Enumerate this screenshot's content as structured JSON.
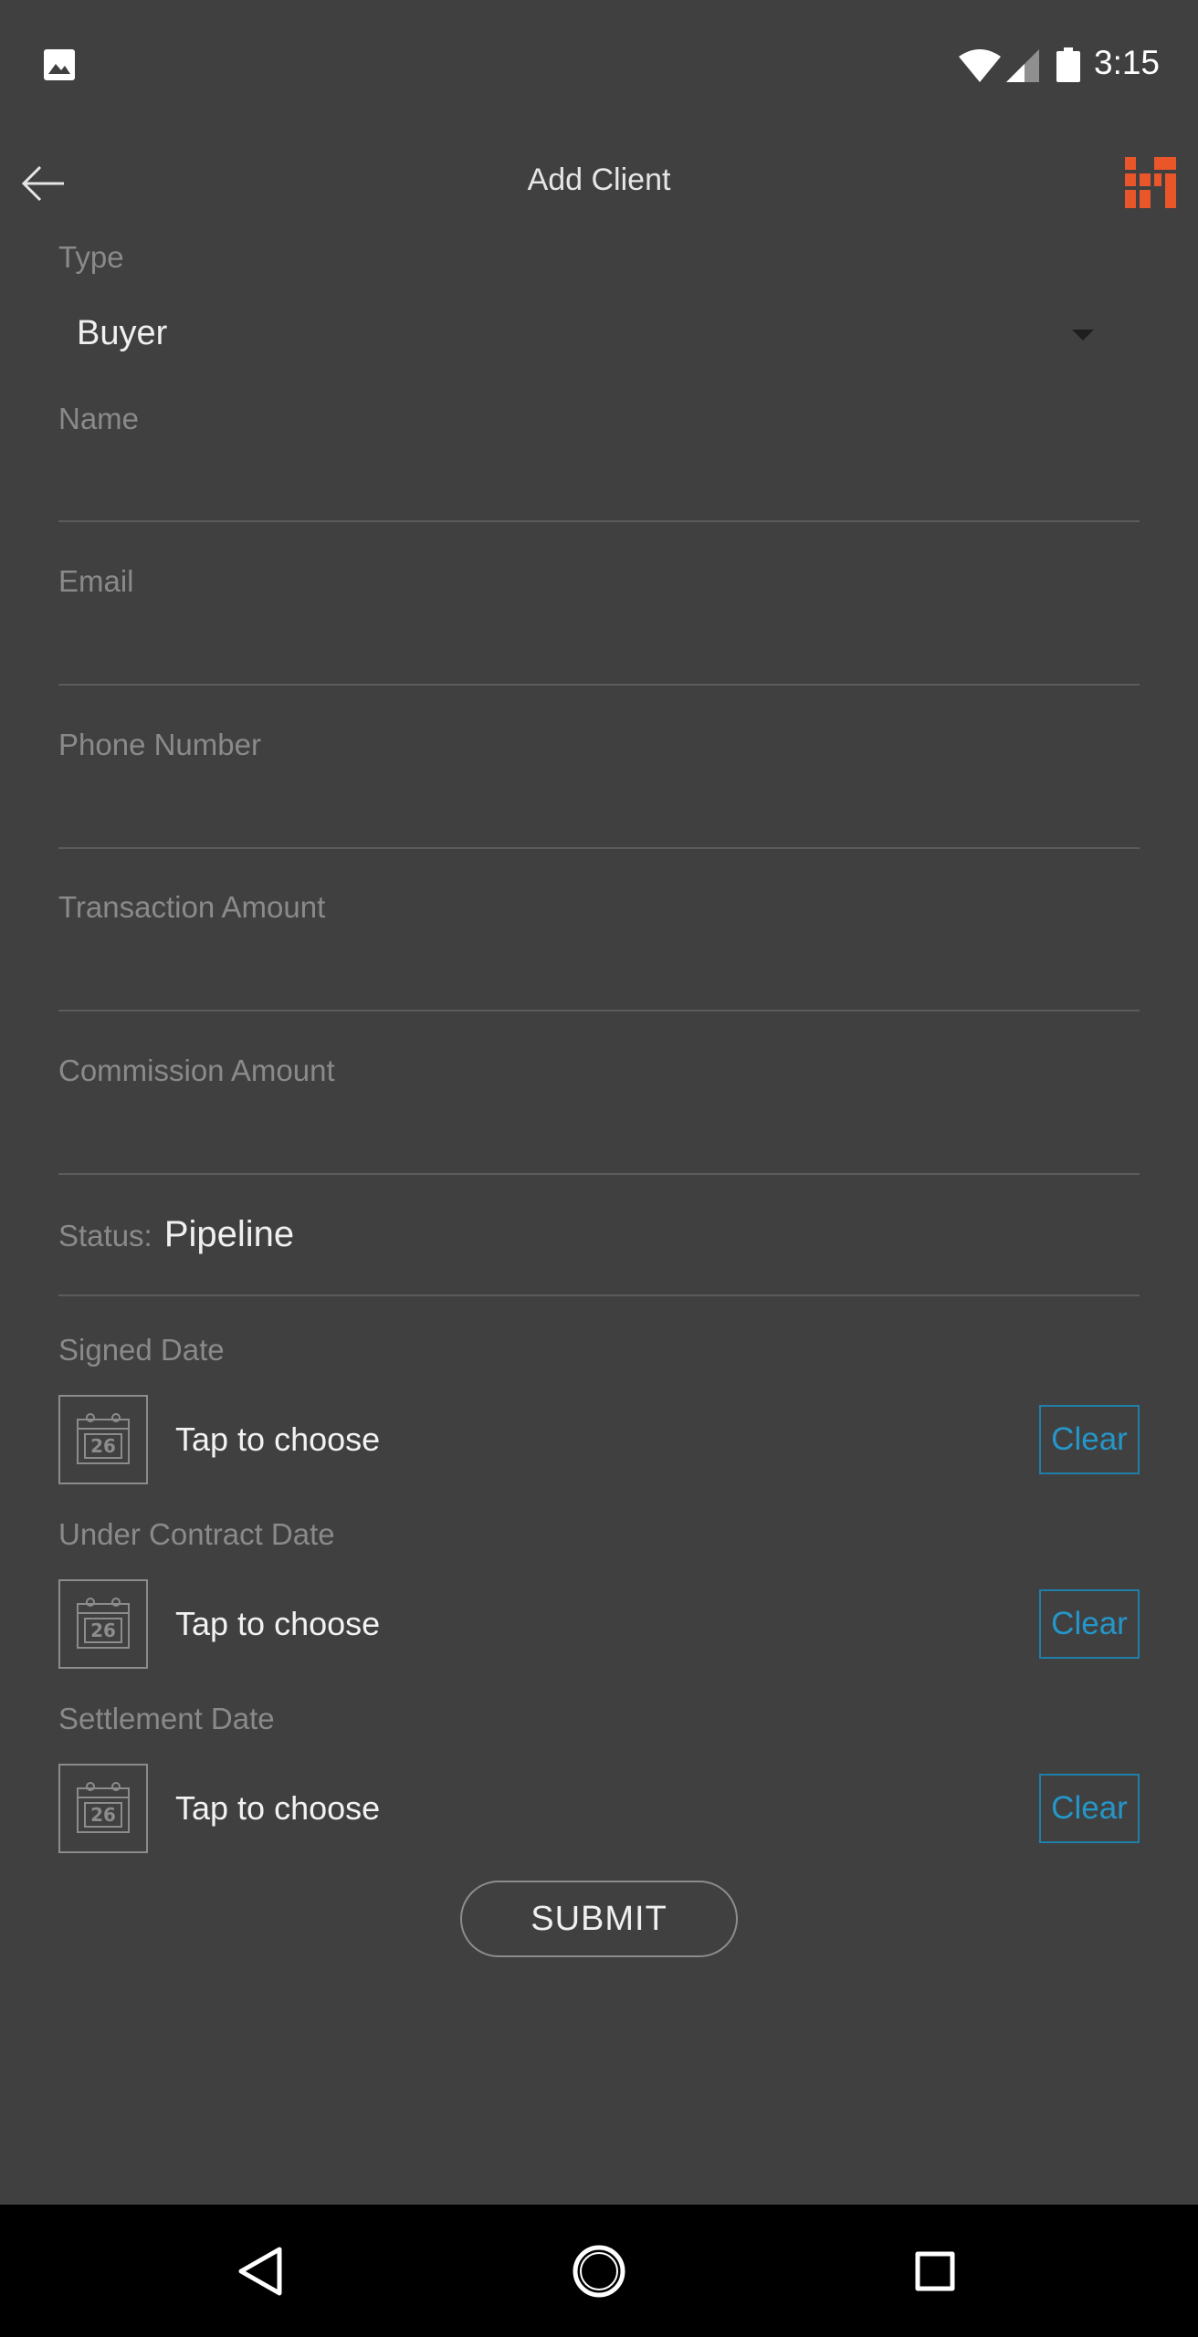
{
  "status_bar": {
    "time": "3:15",
    "icons": [
      "gallery-icon",
      "wifi-icon",
      "signal-icon",
      "battery-icon"
    ]
  },
  "app_bar": {
    "title": "Add Client",
    "back_icon": "arrow-left-icon",
    "logo_icon": "brand-logo-icon",
    "logo_color": "#e8562a"
  },
  "form": {
    "type": {
      "label": "Type",
      "value": "Buyer"
    },
    "name": {
      "label": "Name",
      "value": ""
    },
    "email": {
      "label": "Email",
      "value": ""
    },
    "phone": {
      "label": "Phone Number",
      "value": ""
    },
    "transaction_amount": {
      "label": "Transaction Amount",
      "value": ""
    },
    "commission_amount": {
      "label": "Commission Amount",
      "value": ""
    },
    "status": {
      "label": "Status:",
      "value": "Pipeline"
    },
    "dates": [
      {
        "label": "Signed Date",
        "value": "Tap to choose",
        "calendar_day": "26",
        "clear_label": "Clear"
      },
      {
        "label": "Under Contract Date",
        "value": "Tap to choose",
        "calendar_day": "26",
        "clear_label": "Clear"
      },
      {
        "label": "Settlement Date",
        "value": "Tap to choose",
        "calendar_day": "26",
        "clear_label": "Clear"
      }
    ],
    "submit_label": "SUBMIT"
  },
  "colors": {
    "background": "#404040",
    "accent": "#2596c9",
    "label": "#8a8a8a"
  },
  "nav_bar": {
    "icons": [
      "nav-back-icon",
      "nav-home-icon",
      "nav-recents-icon"
    ]
  }
}
